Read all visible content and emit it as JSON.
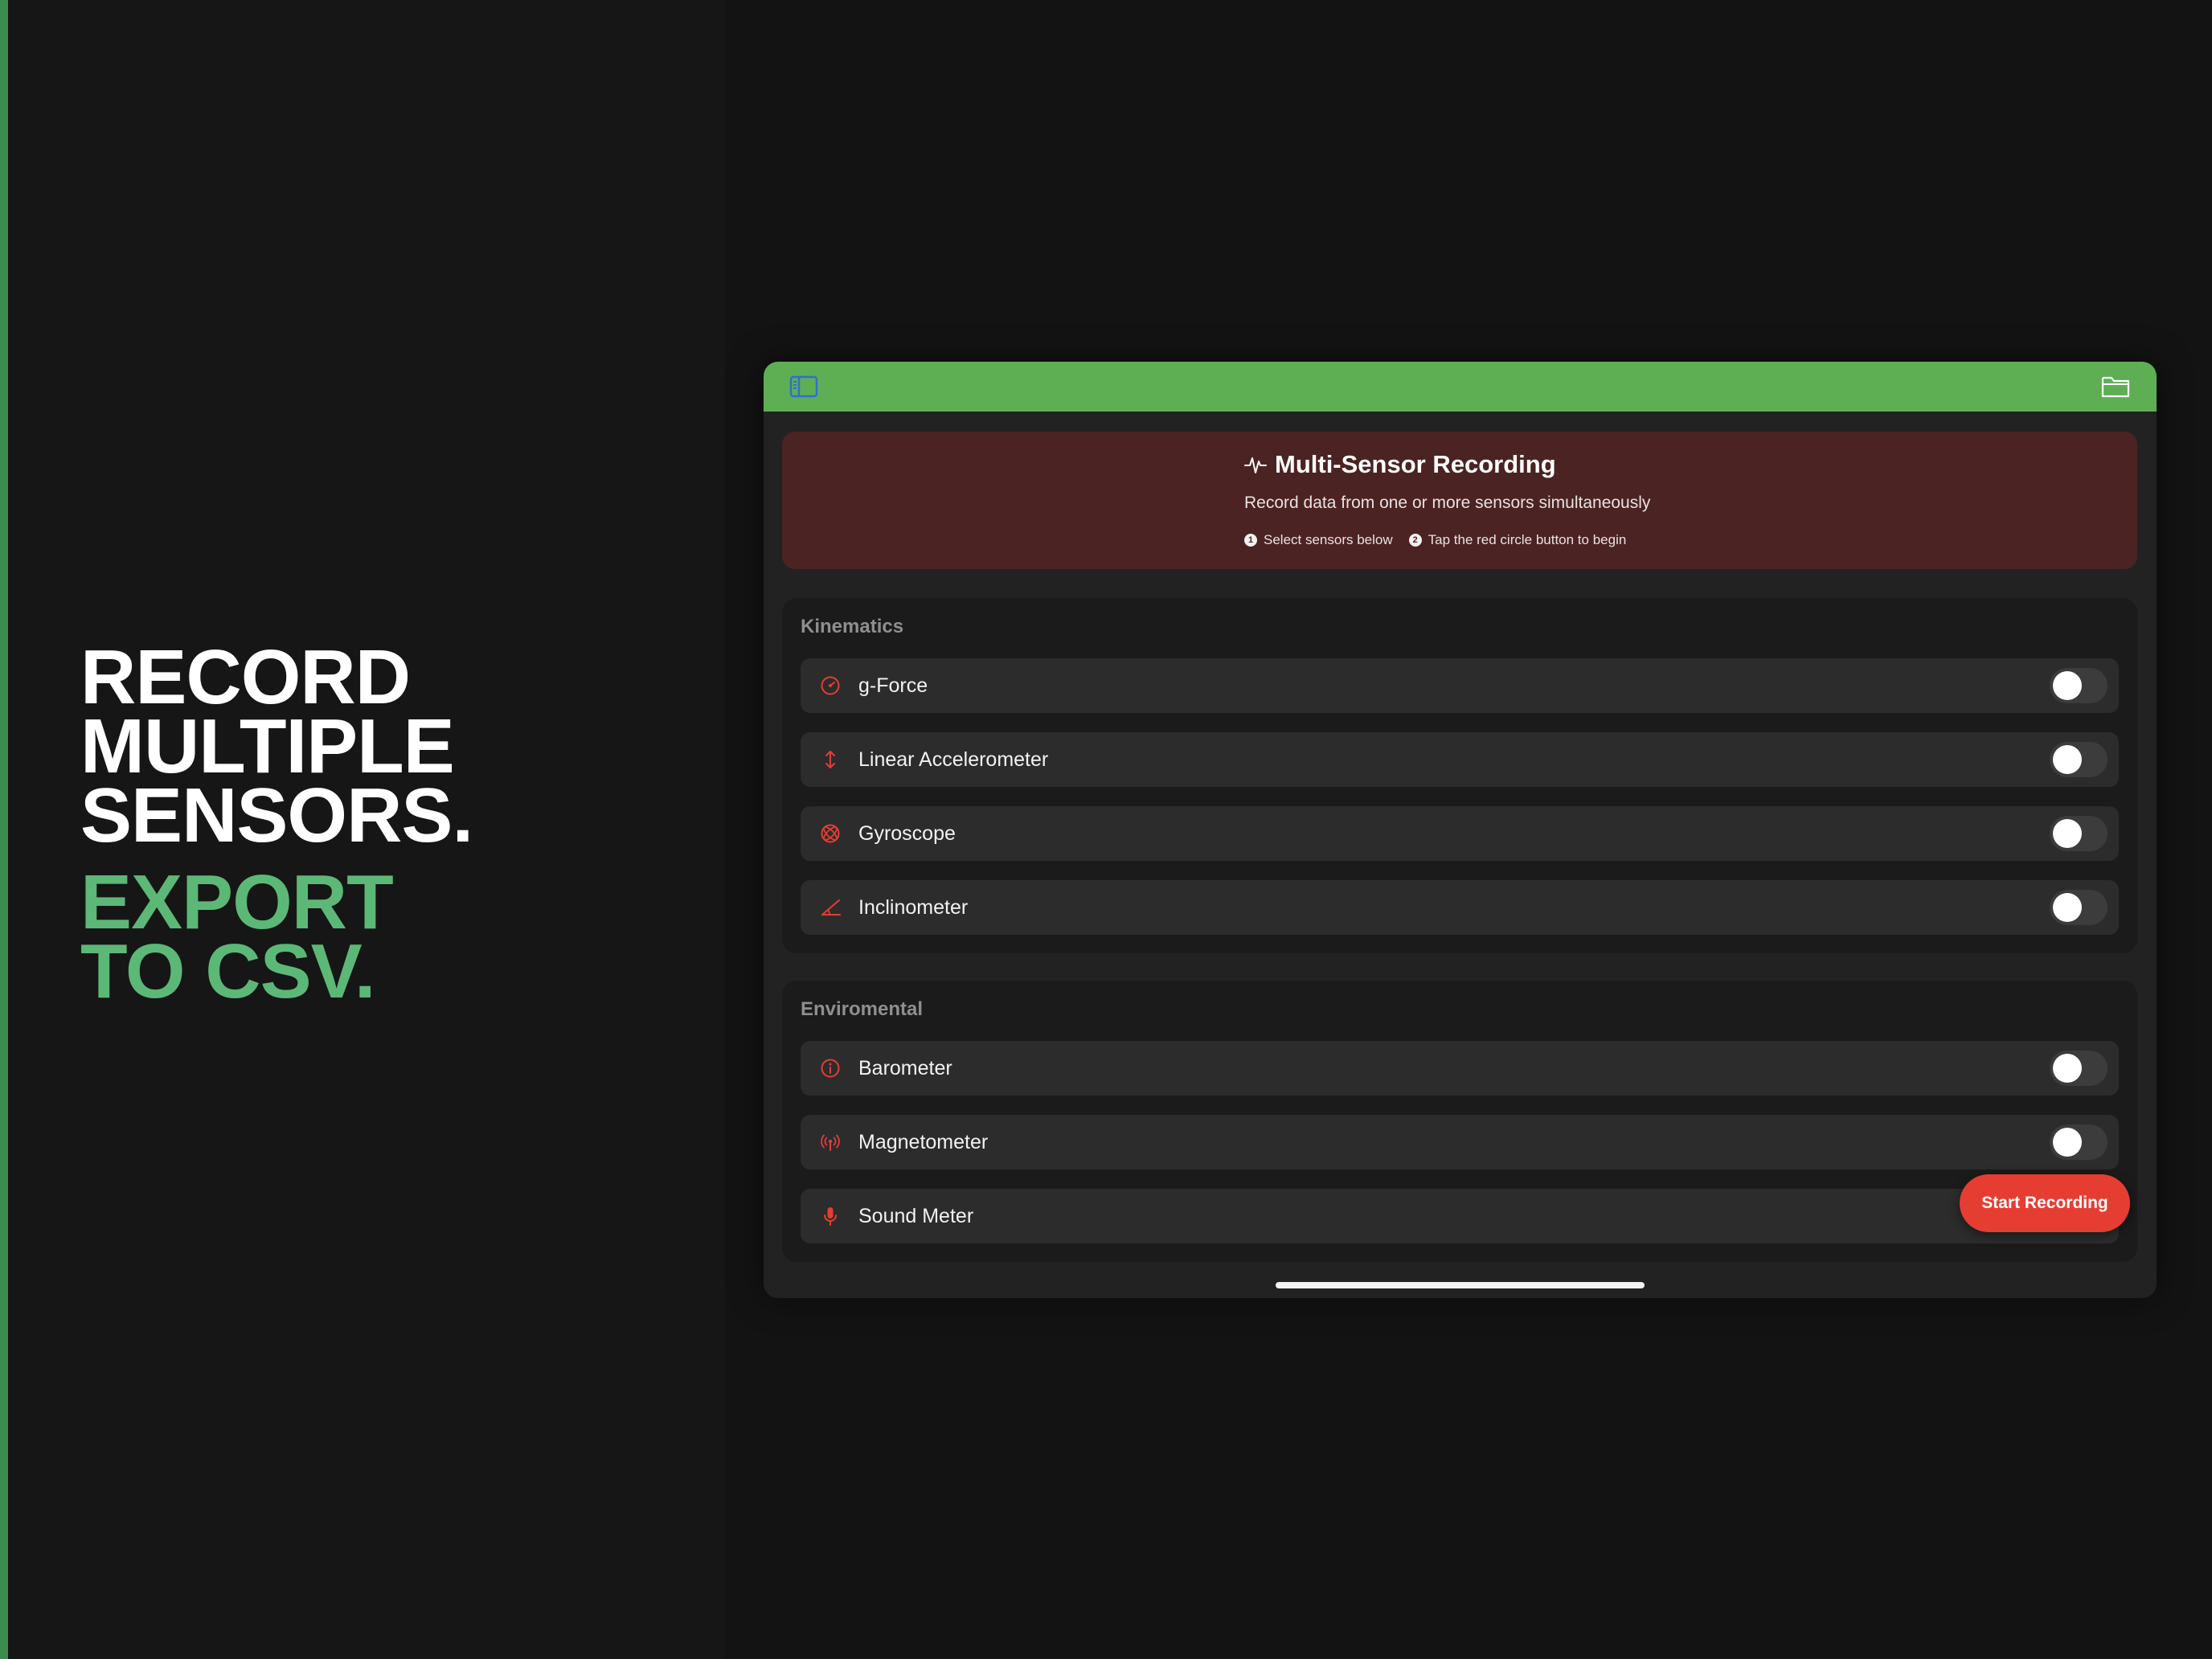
{
  "headline": {
    "line1": "RECORD",
    "line2": "MULTIPLE",
    "line3": "SENSORS.",
    "line4": "EXPORT",
    "line5": "TO CSV."
  },
  "colors": {
    "nav_green": "#5eaf53",
    "accent_red": "#e63d33",
    "banner_bg": "#4b2322",
    "headline_green": "#5cb876"
  },
  "nav": {
    "left_icon": "sidebar-icon",
    "right_icon": "folder-icon"
  },
  "banner": {
    "icon": "waveform-icon",
    "title": "Multi-Sensor Recording",
    "subtitle": "Record data from one or more sensors simultaneously",
    "step1_num": "1",
    "step1": "Select sensors below",
    "step2_num": "2",
    "step2": "Tap the red circle button to begin"
  },
  "sections": [
    {
      "title": "Kinematics",
      "items": [
        {
          "label": "g-Force",
          "icon": "gauge-icon",
          "enabled": false
        },
        {
          "label": "Linear Accelerometer",
          "icon": "arrow-up-down-icon",
          "enabled": false
        },
        {
          "label": "Gyroscope",
          "icon": "gyroscope-icon",
          "enabled": false
        },
        {
          "label": "Inclinometer",
          "icon": "angle-icon",
          "enabled": false
        }
      ]
    },
    {
      "title": "Enviromental",
      "items": [
        {
          "label": "Barometer",
          "icon": "barometer-icon",
          "enabled": false
        },
        {
          "label": "Magnetometer",
          "icon": "antenna-icon",
          "enabled": false
        },
        {
          "label": "Sound Meter",
          "icon": "microphone-icon",
          "enabled": false
        }
      ]
    }
  ],
  "start_button": "Start Recording"
}
